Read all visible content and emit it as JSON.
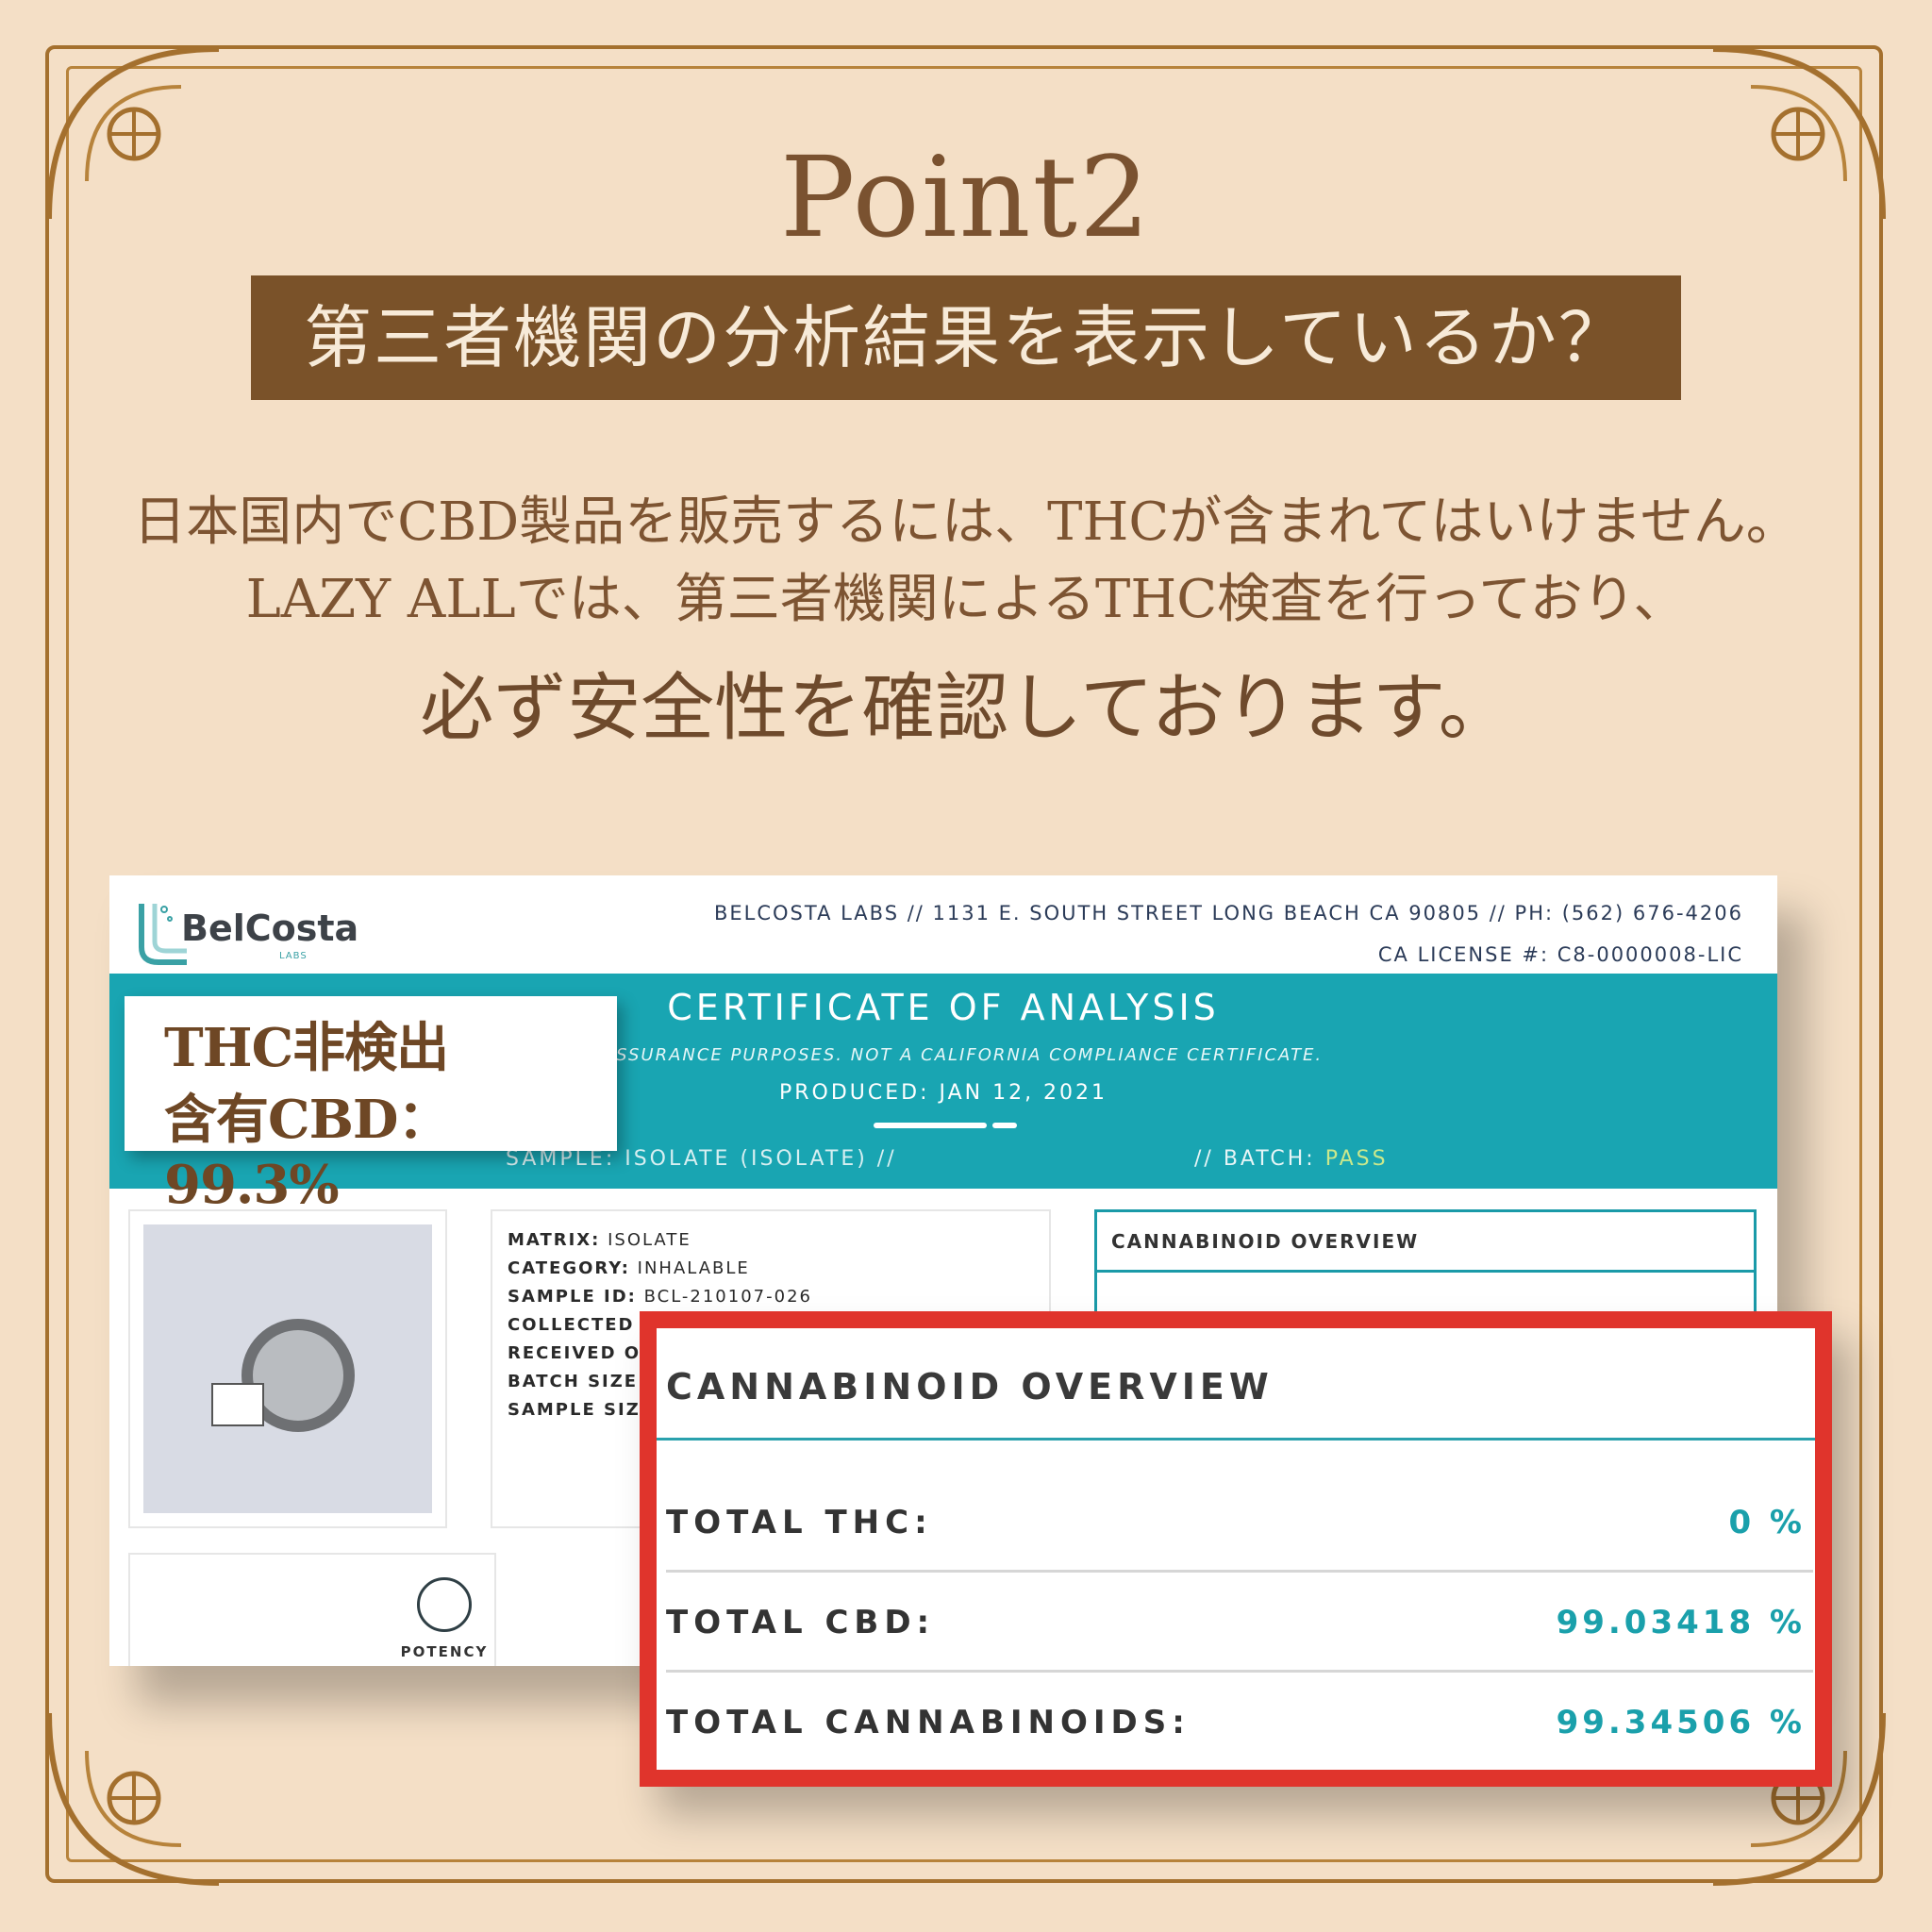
{
  "header": {
    "title": "Point2",
    "banner": "第三者機関の分析結果を表示しているか？"
  },
  "lead": {
    "line1": "日本国内でCBD製品を販売するには、THCが含まれてはいけません。",
    "line2": "LAZY ALLでは、第三者機関によるTHC検査を行っており、",
    "line3": "必ず安全性を確認しております。"
  },
  "certificate": {
    "logo_text": "BelCosta",
    "logo_sub": "LABS",
    "address": "BELCOSTA LABS // 1131 E. SOUTH STREET LONG BEACH CA 90805 // PH: (562) 676-4206",
    "license": "CA LICENSE #: C8-0000008-LIC",
    "title": "CERTIFICATE OF ANALYSIS",
    "subtitle": "ITY ASSURANCE PURPOSES. NOT A CALIFORNIA COMPLIANCE CERTIFICATE.",
    "produced": "PRODUCED: JAN 12, 2021",
    "sample": "SAMPLE: ISOLATE (ISOLATE)   //",
    "batch_label": "//   BATCH: ",
    "batch_value": "PASS",
    "info": {
      "matrix_label": "MATRIX:",
      "matrix_value": " ISOLATE",
      "category_label": "CATEGORY:",
      "category_value": " INHALABLE",
      "sample_id_label": "SAMPLE ID:",
      "sample_id_value": " BCL-210107-026",
      "collected_label": "COLLECTED O",
      "received_label": "RECEIVED ON",
      "batch_size_label": "BATCH SIZE:",
      "sample_size_label": "SAMPLE SIZE"
    },
    "small_overview_title": "CANNABINOID OVERVIEW",
    "potency_label": "POTENCY"
  },
  "callout": {
    "line1": "THC非検出",
    "line2": "含有CBD：99.3%"
  },
  "overview": {
    "title": "CANNABINOID OVERVIEW",
    "rows": [
      {
        "label": "TOTAL THC:",
        "value": "0 %"
      },
      {
        "label": "TOTAL CBD:",
        "value": "99.03418 %"
      },
      {
        "label": "TOTAL CANNABINOIDS:",
        "value": "99.34506 %"
      }
    ]
  },
  "colors": {
    "background": "#f4dfc6",
    "frame": "#a4702e",
    "banner": "#7a5229",
    "teal": "#19a5b2",
    "highlight_border": "#e0342c"
  }
}
